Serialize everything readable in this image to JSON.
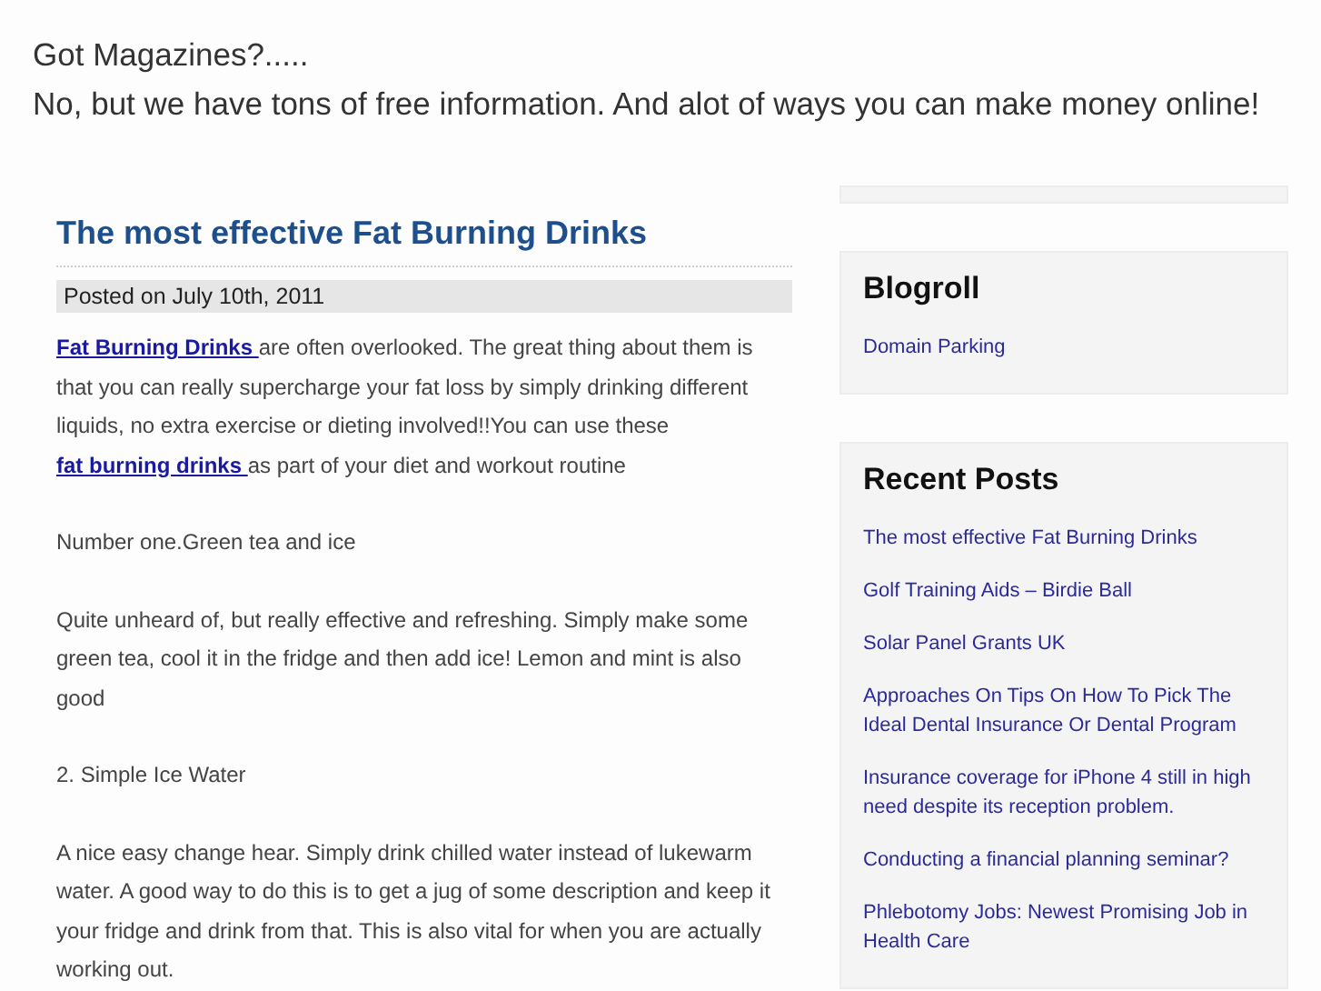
{
  "header": {
    "title": "Got Magazines?.....",
    "tagline": "No, but we have tons of free information. And alot of ways you can make money online!"
  },
  "post": {
    "title": "The most effective Fat Burning Drinks",
    "meta": "Posted on July 10th, 2011",
    "paragraphs": [
      {
        "parts": [
          {
            "kind": "link",
            "text": "Fat Burning Drinks "
          },
          {
            "kind": "text",
            "text": "are often overlooked. The great thing about them is that you can really supercharge your fat loss by simply drinking different liquids, no extra exercise or dieting involved!!You can use these "
          },
          {
            "kind": "link",
            "text": "fat burning drinks "
          },
          {
            "kind": "text",
            "text": "as part of your diet and workout routine"
          }
        ]
      },
      {
        "parts": [
          {
            "kind": "text",
            "text": "Number one.Green tea and ice"
          }
        ]
      },
      {
        "parts": [
          {
            "kind": "text",
            "text": "Quite unheard of, but really effective and refreshing. Simply make some green tea, cool it in the fridge and then add ice! Lemon and mint is also good"
          }
        ]
      },
      {
        "parts": [
          {
            "kind": "text",
            "text": "2. Simple Ice Water"
          }
        ]
      },
      {
        "parts": [
          {
            "kind": "text",
            "text": "A nice easy change hear. Simply drink chilled water instead of lukewarm water. A good way to do this is to get a jug of some description and keep it your fridge and drink from that. This is also vital for when you are actually working out."
          }
        ]
      }
    ]
  },
  "sidebar": {
    "widgets": [
      {
        "title": "Blogroll",
        "links": [
          "Domain Parking"
        ]
      },
      {
        "title": "Recent Posts",
        "links": [
          "The most effective Fat Burning Drinks",
          "Golf Training Aids – Birdie Ball",
          "Solar Panel Grants UK",
          "Approaches On Tips On How To Pick The Ideal Dental Insurance Or Dental Program",
          "Insurance coverage for iPhone 4 still in high need despite its reception problem.",
          "Conducting a financial planning seminar?",
          "Phlebotomy Jobs: Newest Promising Job in Health Care"
        ]
      }
    ]
  }
}
